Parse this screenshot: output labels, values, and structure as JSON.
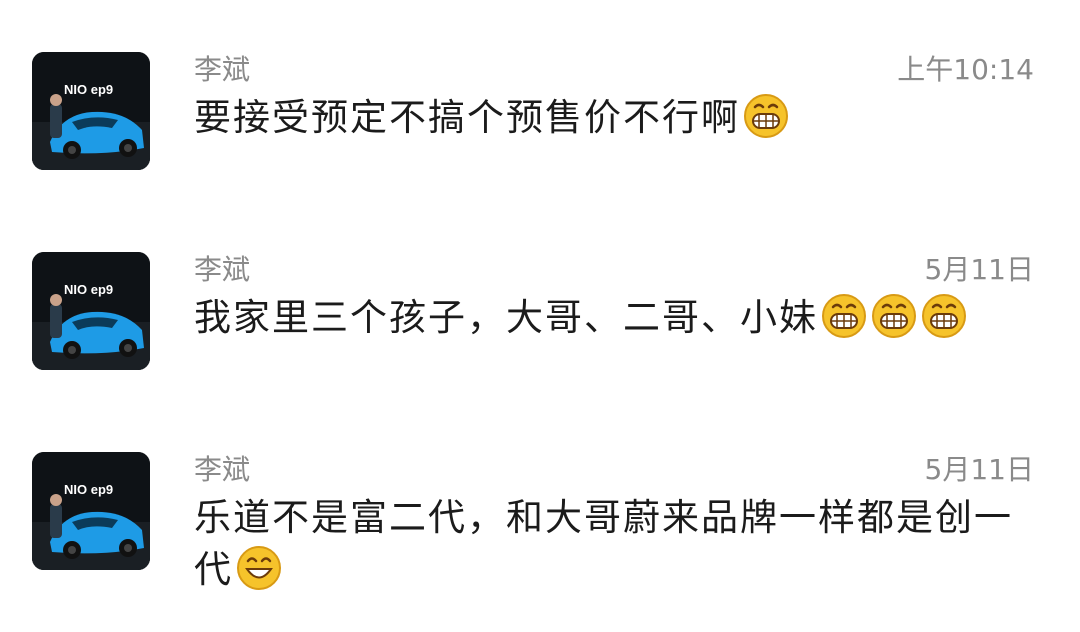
{
  "comments": [
    {
      "author": "李斌",
      "time": "上午10:14",
      "text": "要接受预定不搞个预售价不行啊",
      "emoji": [
        "grin-icon"
      ],
      "avatar": {
        "brand_text": "NIO ep9"
      }
    },
    {
      "author": "李斌",
      "time": "5月11日",
      "text": "我家里三个孩子，大哥、二哥、小妹",
      "emoji": [
        "grin-icon",
        "grin-icon",
        "grin-icon"
      ],
      "avatar": {
        "brand_text": "NIO ep9"
      }
    },
    {
      "author": "李斌",
      "time": "5月11日",
      "text": "乐道不是富二代，和大哥蔚来品牌一样都是创一代",
      "emoji": [
        "smile-icon"
      ],
      "avatar": {
        "brand_text": "NIO ep9"
      }
    }
  ],
  "colors": {
    "meta_text": "#8a8a8a",
    "body_text": "#1b1b1b",
    "car_blue": "#1e9be6",
    "emoji_yellow": "#f6c32b"
  }
}
